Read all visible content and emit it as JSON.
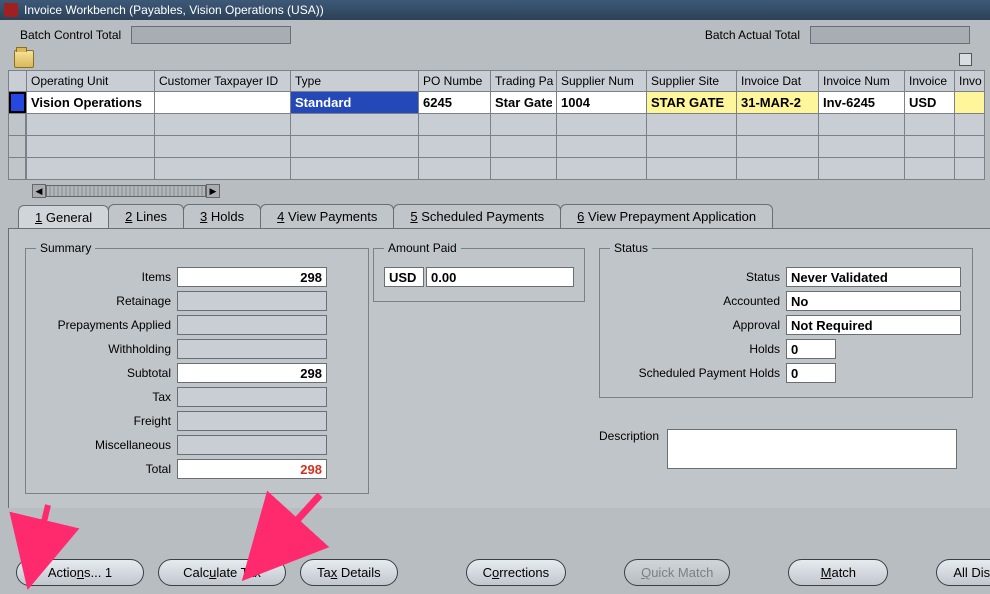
{
  "window": {
    "title": "Invoice Workbench (Payables, Vision Operations (USA))"
  },
  "batch": {
    "control_label": "Batch Control Total",
    "actual_label": "Batch Actual Total",
    "control_value": "",
    "actual_value": ""
  },
  "grid": {
    "headers": [
      "Operating Unit",
      "Customer Taxpayer ID",
      "Type",
      "PO Numbe",
      "Trading Pa",
      "Supplier Num",
      "Supplier Site",
      "Invoice Dat",
      "Invoice Num",
      "Invoice",
      "Invo"
    ],
    "row": {
      "operating_unit": "Vision Operations",
      "customer_taxpayer_id": "",
      "type": "Standard",
      "po_number": "6245",
      "trading_partner": "Star Gate",
      "supplier_num": "1004",
      "supplier_site": "STAR GATE",
      "invoice_date": "31-MAR-2",
      "invoice_num": "Inv-6245",
      "invoice_curr": "USD",
      "invoice_tail": ""
    }
  },
  "tabs": [
    {
      "mn": "1",
      "label": "General"
    },
    {
      "mn": "2",
      "label": "Lines"
    },
    {
      "mn": "3",
      "label": "Holds"
    },
    {
      "mn": "4",
      "label": "View Payments"
    },
    {
      "mn": "5",
      "label": "Scheduled Payments"
    },
    {
      "mn": "6",
      "label": "View Prepayment Application"
    }
  ],
  "summary": {
    "legend": "Summary",
    "items_label": "Items",
    "items": "298",
    "retainage_label": "Retainage",
    "retainage": "",
    "prepay_label": "Prepayments Applied",
    "prepay": "",
    "withholding_label": "Withholding",
    "withholding": "",
    "subtotal_label": "Subtotal",
    "subtotal": "298",
    "tax_label": "Tax",
    "tax": "",
    "freight_label": "Freight",
    "freight": "",
    "misc_label": "Miscellaneous",
    "misc": "",
    "total_label": "Total",
    "total": "298"
  },
  "amount_paid": {
    "legend": "Amount Paid",
    "currency": "USD",
    "value": "0.00"
  },
  "status": {
    "legend": "Status",
    "status_label": "Status",
    "status": "Never Validated",
    "accounted_label": "Accounted",
    "accounted": "No",
    "approval_label": "Approval",
    "approval": "Not Required",
    "holds_label": "Holds",
    "holds": "0",
    "sph_label": "Scheduled Payment Holds",
    "sph": "0"
  },
  "description": {
    "label": "Description",
    "value": ""
  },
  "buttons": {
    "actions": "Actions... 1",
    "calc_tax": "Calculate Tax",
    "tax_details": "Tax Details",
    "corrections": "Corrections",
    "quick_match": "Quick Match",
    "match": "Match",
    "all_dist": "All Distributions"
  }
}
